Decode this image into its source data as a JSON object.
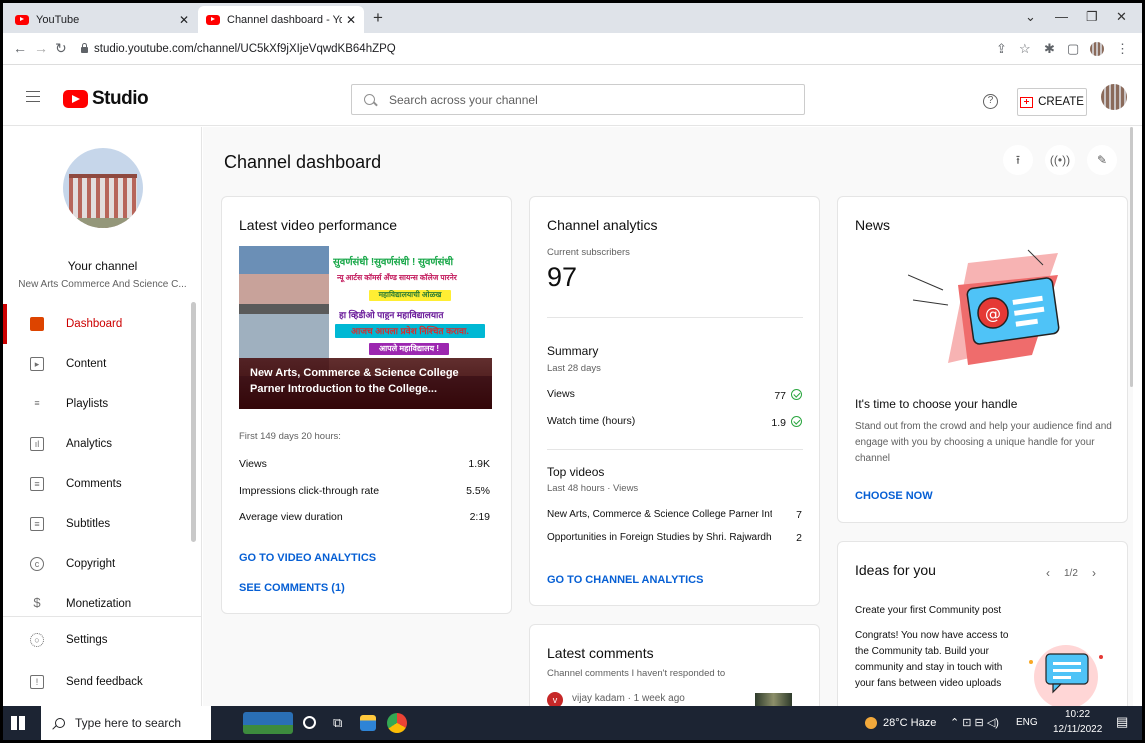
{
  "browser": {
    "tabs": [
      {
        "title": "YouTube"
      },
      {
        "title": "Channel dashboard - YouTube St"
      }
    ],
    "new_tab_symbol": "+",
    "url": "studio.youtube.com/channel/UC5kXf9jXIjeVqwdKB64hZPQ"
  },
  "header": {
    "logo_text": "Studio",
    "search_placeholder": "Search across your channel",
    "help_symbol": "?",
    "create_label": "CREATE"
  },
  "sidebar": {
    "channel_title": "Your channel",
    "channel_name": "New Arts Commerce And Science C...",
    "items": [
      {
        "label": "Dashboard",
        "icon": "dashboard-icon",
        "active": true
      },
      {
        "label": "Content",
        "icon": "content-icon"
      },
      {
        "label": "Playlists",
        "icon": "playlists-icon"
      },
      {
        "label": "Analytics",
        "icon": "analytics-icon"
      },
      {
        "label": "Comments",
        "icon": "comments-icon"
      },
      {
        "label": "Subtitles",
        "icon": "subtitles-icon"
      },
      {
        "label": "Copyright",
        "icon": "copyright-icon"
      },
      {
        "label": "Monetization",
        "icon": "monetization-icon"
      },
      {
        "label": "Settings",
        "icon": "settings-icon"
      },
      {
        "label": "Send feedback",
        "icon": "feedback-icon"
      }
    ]
  },
  "main": {
    "page_title": "Channel dashboard",
    "latest_video": {
      "title": "Latest video performance",
      "thumbnail_lines": [
        "सुवर्णसंधी !सुवर्णसंधी ! सुवर्णसंधी",
        "न्यू आर्टस कॉमर्स अँण्ड सायन्स कॉलेज पारनेर",
        "महाविद्यालयाची ओळख",
        "हा व्हिडीओ पाहून महाविद्यालयात",
        "आजच आपला प्रवेश निश्चित करावा.",
        "आपले महाविद्यालय !"
      ],
      "thumbnail_caption_1": "New Arts, Commerce & Science College",
      "thumbnail_caption_2": "Parner Introduction to the College...",
      "period": "First 149 days 20 hours:",
      "stats": [
        {
          "label": "Views",
          "value": "1.9K"
        },
        {
          "label": "Impressions click-through rate",
          "value": "5.5%"
        },
        {
          "label": "Average view duration",
          "value": "2:19"
        }
      ],
      "link_analytics": "GO TO VIDEO ANALYTICS",
      "link_comments": "SEE COMMENTS (1)"
    },
    "analytics": {
      "title": "Channel analytics",
      "subs_label": "Current subscribers",
      "subs_value": "97",
      "summary_title": "Summary",
      "summary_period": "Last 28 days",
      "summary": [
        {
          "label": "Views",
          "value": "77"
        },
        {
          "label": "Watch time (hours)",
          "value": "1.9"
        }
      ],
      "top_title": "Top videos",
      "top_period": "Last 48 hours · Views",
      "top_videos": [
        {
          "title": "New Arts, Commerce & Science College Parner Introdu...",
          "views": "7"
        },
        {
          "title": "Opportunities in Foreign Studies by Shri. Rajwardhan P. ...",
          "views": "2"
        }
      ],
      "link": "GO TO CHANNEL ANALYTICS"
    },
    "comments": {
      "title": "Latest comments",
      "subtitle": "Channel comments I haven't responded to",
      "first_author": "vijay kadam · 1 week ago",
      "avatar_letter": "v"
    },
    "news": {
      "title": "News",
      "headline": "It's time to choose your handle",
      "body": "Stand out from the crowd and help your audience find and engage with you by choosing a unique handle for your channel",
      "link": "CHOOSE NOW"
    },
    "ideas": {
      "title": "Ideas for you",
      "pager": "1/2",
      "subtitle": "Create your first Community post",
      "body": "Congrats! You now have access to the Community tab. Build your community and stay in touch with your fans between video uploads"
    }
  },
  "taskbar": {
    "search_placeholder": "Type here to search",
    "weather": "28°C Haze",
    "lang": "ENG",
    "time": "10:22",
    "date": "12/11/2022"
  }
}
